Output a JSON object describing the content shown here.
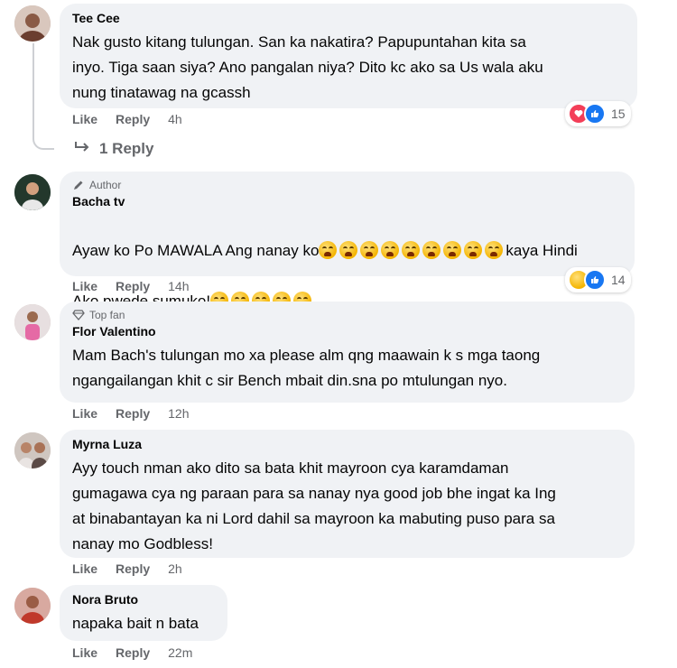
{
  "comments": [
    {
      "name": "Tee Cee",
      "badge": "",
      "text": "Nak gusto kitang tulungan. San ka nakatira? Papupuntahan kita sa\ninyo. Tiga saan siya? Ano pangalan niya? Dito kc ako sa Us wala aku\nnung tinatawag na gcassh",
      "like": "Like",
      "reply": "Reply",
      "time": "4h",
      "reactions": {
        "icons": [
          "love",
          "like"
        ],
        "count": "15"
      },
      "replies_label": "1 Reply"
    },
    {
      "name": "Bacha tv",
      "badge": "Author",
      "text_line1": "Ayaw ko Po MAWALA Ang nanay ko",
      "text_line1_after": "kaya Hindi",
      "text_line2": "Ako pwede sumuko!",
      "emoji_count_line1": 9,
      "emoji_count_line2": 5,
      "like": "Like",
      "reply": "Reply",
      "time": "14h",
      "reactions": {
        "icons": [
          "sad",
          "like"
        ],
        "count": "14"
      }
    },
    {
      "name": "Flor Valentino",
      "badge": "Top fan",
      "text": "Mam Bach's tulungan mo xa please alm qng maawain k s mga taong\nngangailangan khit c sir Bench mbait din.sna po mtulungan nyo.",
      "like": "Like",
      "reply": "Reply",
      "time": "12h"
    },
    {
      "name": "Myrna Luza",
      "badge": "",
      "text": "Ayy touch nman ako dito sa bata khit mayroon cya karamdaman\ngumagawa cya ng paraan para sa nanay nya good job bhe ingat ka Ing\nat binabantayan ka ni Lord dahil sa mayroon ka mabuting puso para sa\nnanay mo Godbless!",
      "like": "Like",
      "reply": "Reply",
      "time": "2h"
    },
    {
      "name": "Nora Bruto",
      "badge": "",
      "text": "napaka bait n bata",
      "like": "Like",
      "reply": "Reply",
      "time": "22m"
    }
  ],
  "colors": {
    "bubble": "#f0f2f5",
    "meta": "#65676b",
    "like_blue": "#1877f2",
    "love_red": "#f33e58"
  }
}
